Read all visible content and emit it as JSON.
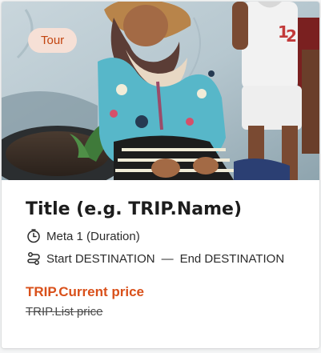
{
  "card": {
    "badge_label": "Tour",
    "title": "Title (e.g. TRIP.Name)",
    "meta_duration": "Meta 1 (Duration)",
    "route_start": "Start DESTINATION",
    "route_separator": "—",
    "route_end": "End DESTINATION",
    "current_price": "TRIP.Current price",
    "list_price": "TRIP.List price",
    "icons": {
      "duration": "timer-icon",
      "route": "route-icon"
    }
  },
  "colors": {
    "accent": "#d9501a",
    "badge_bg": "#f6e0d6",
    "badge_text": "#c2440f",
    "title": "#1c1c1c"
  }
}
